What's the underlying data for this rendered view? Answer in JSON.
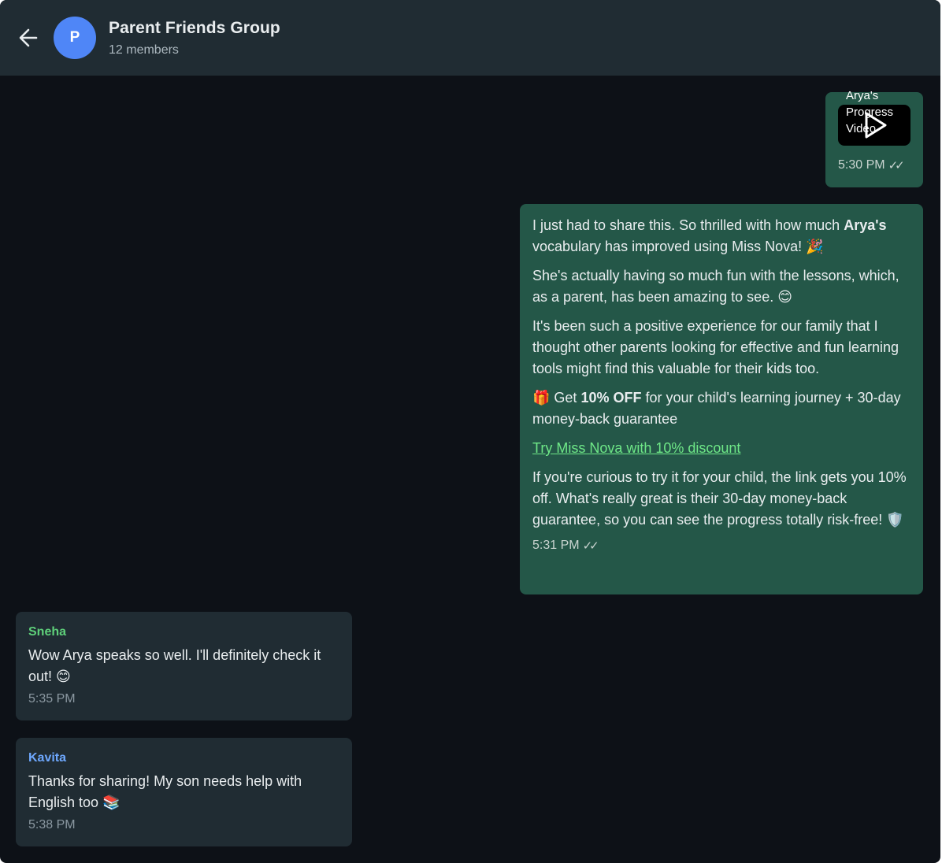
{
  "header": {
    "avatar_initial": "P",
    "title": "Parent Friends Group",
    "subtitle": "12 members"
  },
  "messages": {
    "video": {
      "caption": "Arya's Progress Video",
      "time": "5:30 PM",
      "ticks": "✓✓"
    },
    "promo": {
      "p1_before": "I just had to share this. So thrilled with how much ",
      "p1_bold": "Arya's",
      "p1_after": " vocabulary has improved using Miss Nova! 🎉",
      "p2": "She's actually having so much fun with the lessons, which, as a parent, has been amazing to see. 😊",
      "p3": "It's been such a positive experience for our family that I thought other parents looking for effective and fun learning tools might find this valuable for their kids too.",
      "offer_before": "🎁 Get ",
      "offer_bold": "10% OFF",
      "offer_after": " for your child's learning journey + 30-day money-back guarantee",
      "link": "Try Miss Nova with 10% discount",
      "p4": "If you're curious to try it for your child, the link gets you 10% off. What's really great is their 30-day money-back guarantee, so you can see the progress totally risk-free! 🛡️",
      "time": "5:31 PM",
      "ticks": "✓✓"
    },
    "incoming": [
      {
        "sender": "Sneha",
        "text": "Wow Arya speaks so well. I'll definitely check it out! 😊",
        "time": "5:35 PM"
      },
      {
        "sender": "Kavita",
        "text": "Thanks for sharing! My son needs help with English too 📚",
        "time": "5:38 PM"
      }
    ]
  },
  "colors": {
    "background": "#0d1117",
    "header": "#202c33",
    "outgoing_bubble": "#245748",
    "incoming_bubble": "#202c33",
    "avatar": "#4f86f7",
    "link": "#6ee787",
    "sender_sneha": "#5ed07a",
    "sender_kavita": "#6ea8fe"
  },
  "icons": {
    "back": "arrow-left-icon",
    "play": "play-icon",
    "read_receipt": "double-check-icon"
  }
}
